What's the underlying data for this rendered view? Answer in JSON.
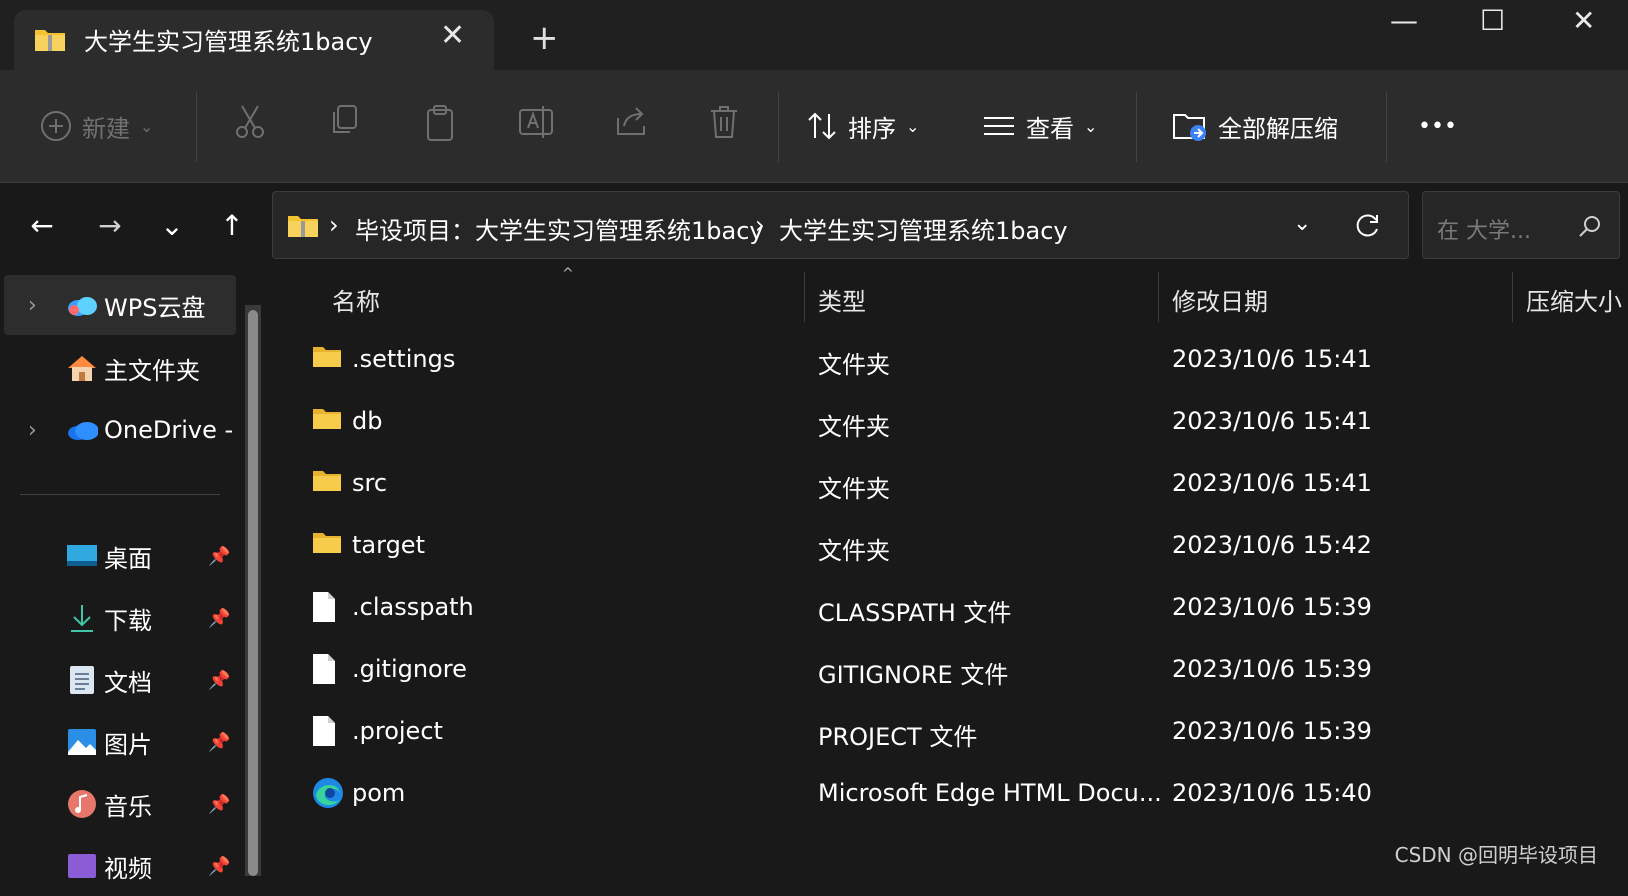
{
  "tab": {
    "title": "大学生实习管理系统1bacy",
    "close": "✕",
    "new_tab": "+"
  },
  "window": {
    "minimize": "—",
    "maximize": "☐",
    "close": "✕"
  },
  "toolbar": {
    "new_label": "新建",
    "sort_label": "排序",
    "view_label": "查看",
    "extract_all_label": "全部解压缩",
    "more": "•••"
  },
  "nav": {
    "back": "←",
    "forward": "→",
    "recent": "⌄",
    "up": "↑"
  },
  "address": {
    "crumbs": [
      "毕设项目：大学生实习管理系统1bacy",
      "大学生实习管理系统1bacy"
    ],
    "separator": "›"
  },
  "search": {
    "placeholder": "在 大学..."
  },
  "sidebar": {
    "items": [
      {
        "label": "WPS云盘",
        "icon": "wps-cloud-icon"
      },
      {
        "label": "主文件夹",
        "icon": "home-icon"
      },
      {
        "label": "OneDrive -",
        "icon": "onedrive-icon"
      }
    ],
    "quick": [
      {
        "label": "桌面",
        "icon": "desktop-icon"
      },
      {
        "label": "下载",
        "icon": "download-icon"
      },
      {
        "label": "文档",
        "icon": "documents-icon"
      },
      {
        "label": "图片",
        "icon": "pictures-icon"
      },
      {
        "label": "音乐",
        "icon": "music-icon"
      },
      {
        "label": "视频",
        "icon": "videos-icon"
      }
    ]
  },
  "columns": {
    "name": "名称",
    "type": "类型",
    "modified": "修改日期",
    "size": "压缩大小"
  },
  "files": [
    {
      "name": ".settings",
      "type": "文件夹",
      "modified": "2023/10/6 15:41",
      "icon": "folder-icon"
    },
    {
      "name": "db",
      "type": "文件夹",
      "modified": "2023/10/6 15:41",
      "icon": "folder-icon"
    },
    {
      "name": "src",
      "type": "文件夹",
      "modified": "2023/10/6 15:41",
      "icon": "folder-icon"
    },
    {
      "name": "target",
      "type": "文件夹",
      "modified": "2023/10/6 15:42",
      "icon": "folder-icon"
    },
    {
      "name": ".classpath",
      "type": "CLASSPATH 文件",
      "modified": "2023/10/6 15:39",
      "icon": "file-icon"
    },
    {
      "name": ".gitignore",
      "type": "GITIGNORE 文件",
      "modified": "2023/10/6 15:39",
      "icon": "file-icon"
    },
    {
      "name": ".project",
      "type": "PROJECT 文件",
      "modified": "2023/10/6 15:39",
      "icon": "file-icon"
    },
    {
      "name": "pom",
      "type": "Microsoft Edge HTML Docu...",
      "modified": "2023/10/6 15:40",
      "icon": "edge-icon"
    }
  ],
  "watermark": "CSDN @回明毕设项目",
  "colors": {
    "accent_folder": "#f4c430",
    "background": "#191919",
    "toolbar": "#2c2c2c"
  }
}
